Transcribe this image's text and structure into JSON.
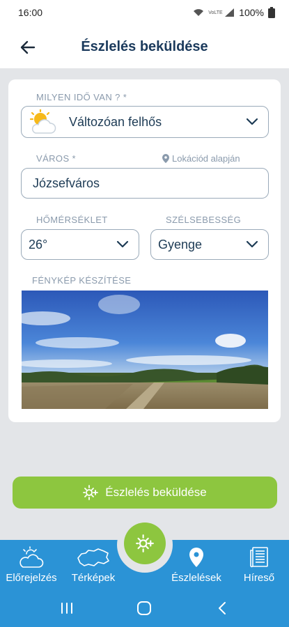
{
  "status": {
    "time": "16:00",
    "battery": "100%",
    "network": "VoLTE"
  },
  "header": {
    "title": "Észlelés beküldése"
  },
  "form": {
    "weather": {
      "label": "MILYEN IDŐ VAN ? *",
      "value": "Változóan felhős",
      "icon": "partly-cloudy-icon"
    },
    "city": {
      "label": "VÁROS *",
      "value": "Józsefváros",
      "location_link": "Lokációd alapján"
    },
    "temperature": {
      "label": "HŐMÉRSÉKLET",
      "value": "26°"
    },
    "wind": {
      "label": "SZÉLSEBESSÉG",
      "value": "Gyenge"
    },
    "photo": {
      "label": "FÉNYKÉP KÉSZÍTÉSE"
    }
  },
  "submit": {
    "label": "Észlelés beküldése"
  },
  "nav": {
    "items": [
      {
        "label": "Előrejelzés",
        "icon": "cloud-sun-icon"
      },
      {
        "label": "Térképek",
        "icon": "map-icon"
      },
      {
        "label": "Észlelések",
        "icon": "location-pin-icon"
      },
      {
        "label": "Híreső",
        "icon": "newspaper-icon"
      }
    ]
  },
  "colors": {
    "accent": "#8dc63f",
    "nav": "#2b93d6",
    "title": "#1b3a5c"
  }
}
